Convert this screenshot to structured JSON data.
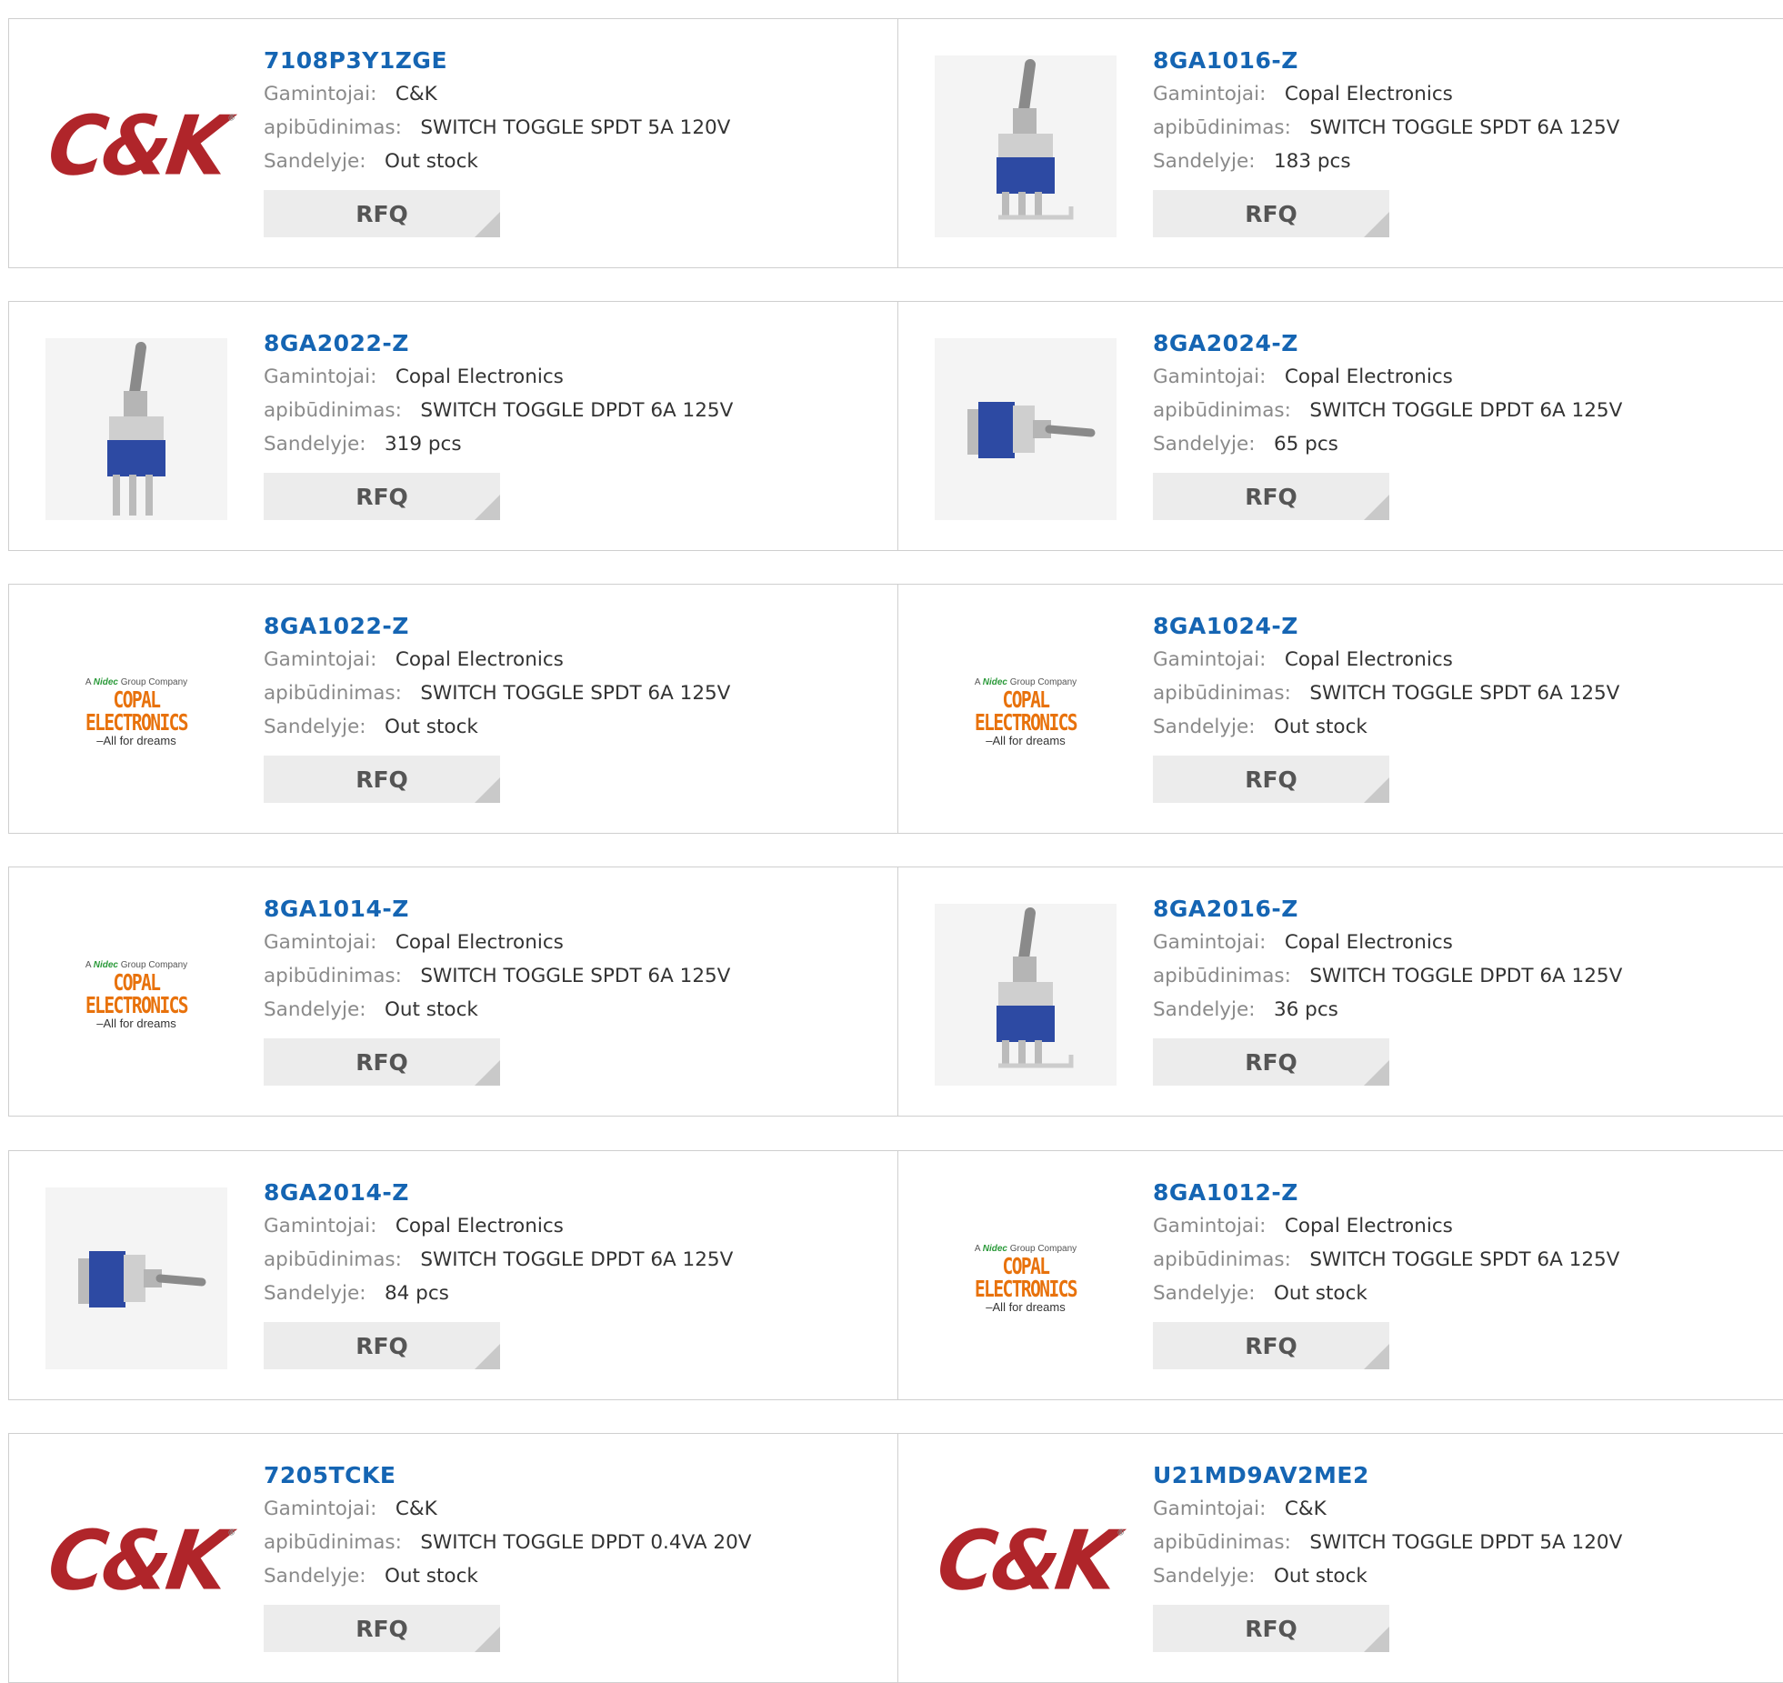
{
  "labels": {
    "manufacturer": "Gamintojai:",
    "description": "apibūdinimas:",
    "stock": "Sandelyje:",
    "rfq": "RFQ"
  },
  "logos": {
    "ck": "C&K",
    "ck_reg": "®",
    "copal_top_a": "A",
    "copal_top_brand": "Nidec",
    "copal_top_rest": "Group Company",
    "copal_main": "COPAL ELECTRONICS",
    "copal_sub": "–All for dreams"
  },
  "colors": {
    "part_number": "#1565b3",
    "ck_red": "#b0252a",
    "copal_orange": "#e8720c"
  },
  "products": [
    {
      "part": "7108P3Y1ZGE",
      "manufacturer": "C&K",
      "description": "SWITCH TOGGLE SPDT 5A 120V",
      "stock": "Out stock",
      "image": "ck-logo"
    },
    {
      "part": "8GA1016-Z",
      "manufacturer": "Copal Electronics",
      "description": "SWITCH TOGGLE SPDT 6A 125V",
      "stock": "183 pcs",
      "image": "toggle-switch-vertical"
    },
    {
      "part": "8GA2022-Z",
      "manufacturer": "Copal Electronics",
      "description": "SWITCH TOGGLE DPDT 6A 125V",
      "stock": "319 pcs",
      "image": "toggle-switch-vertical-pins"
    },
    {
      "part": "8GA2024-Z",
      "manufacturer": "Copal Electronics",
      "description": "SWITCH TOGGLE DPDT 6A 125V",
      "stock": "65 pcs",
      "image": "toggle-switch-horizontal"
    },
    {
      "part": "8GA1022-Z",
      "manufacturer": "Copal Electronics",
      "description": "SWITCH TOGGLE SPDT 6A 125V",
      "stock": "Out stock",
      "image": "copal-logo"
    },
    {
      "part": "8GA1024-Z",
      "manufacturer": "Copal Electronics",
      "description": "SWITCH TOGGLE SPDT 6A 125V",
      "stock": "Out stock",
      "image": "copal-logo"
    },
    {
      "part": "8GA1014-Z",
      "manufacturer": "Copal Electronics",
      "description": "SWITCH TOGGLE SPDT 6A 125V",
      "stock": "Out stock",
      "image": "copal-logo"
    },
    {
      "part": "8GA2016-Z",
      "manufacturer": "Copal Electronics",
      "description": "SWITCH TOGGLE DPDT 6A 125V",
      "stock": "36 pcs",
      "image": "toggle-switch-vertical"
    },
    {
      "part": "8GA2014-Z",
      "manufacturer": "Copal Electronics",
      "description": "SWITCH TOGGLE DPDT 6A 125V",
      "stock": "84 pcs",
      "image": "toggle-switch-horizontal"
    },
    {
      "part": "8GA1012-Z",
      "manufacturer": "Copal Electronics",
      "description": "SWITCH TOGGLE SPDT 6A 125V",
      "stock": "Out stock",
      "image": "copal-logo"
    },
    {
      "part": "7205TCKE",
      "manufacturer": "C&K",
      "description": "SWITCH TOGGLE DPDT 0.4VA 20V",
      "stock": "Out stock",
      "image": "ck-logo"
    },
    {
      "part": "U21MD9AV2ME2",
      "manufacturer": "C&K",
      "description": "SWITCH TOGGLE DPDT 5A 120V",
      "stock": "Out stock",
      "image": "ck-logo"
    }
  ]
}
